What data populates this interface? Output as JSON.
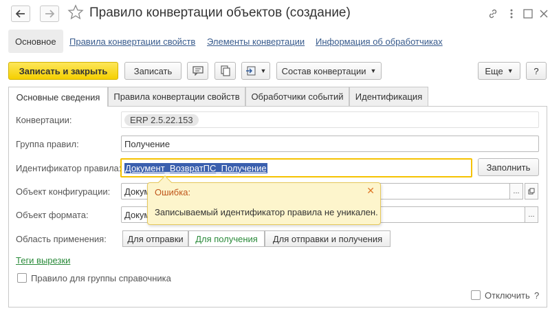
{
  "window": {
    "title": "Правило конвертации объектов (создание)"
  },
  "sections": {
    "active": "Основное",
    "links": [
      "Правила конвертации свойств",
      "Элементы конвертации",
      "Информация об обработчиках"
    ]
  },
  "toolbar": {
    "save_close": "Записать и закрыть",
    "save": "Записать",
    "composition": "Состав конвертации",
    "more": "Еще",
    "help": "?"
  },
  "tabs": [
    "Основные сведения",
    "Правила конвертации свойств",
    "Обработчики событий",
    "Идентификация"
  ],
  "form": {
    "conversions_label": "Конвертации:",
    "conversions_value": "ERP 2.5.22.153",
    "group_label": "Группа правил:",
    "group_value": "Получение",
    "id_label": "Идентификатор правила:",
    "id_value": "Документ_ВозвратПС_Получение",
    "fill_button": "Заполнить",
    "config_object_label": "Объект конфигурации:",
    "config_object_value": "Докум",
    "format_object_label": "Объект формата:",
    "format_object_value": "Докум",
    "scope_label": "Область применения:",
    "scope_options": [
      "Для отправки",
      "Для получения",
      "Для отправки и получения"
    ],
    "scope_selected": "Для получения",
    "tags_link": "Теги вырезки",
    "group_rule_checkbox": "Правило для группы справочника",
    "disable_checkbox": "Отключить",
    "help_mark": "?"
  },
  "error_popup": {
    "title": "Ошибка:",
    "message": "Записываемый идентификатор правила не уникален."
  },
  "colors": {
    "primary_button": "#f5d000",
    "link": "#375a8c",
    "active_option": "#2a8a3a",
    "selection": "#3a5fae",
    "error_title": "#c0551a"
  }
}
